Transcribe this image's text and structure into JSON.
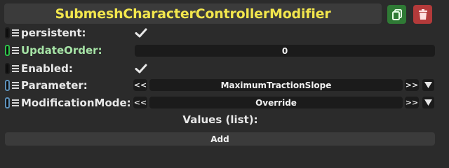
{
  "component": {
    "title": "SubmeshCharacterControllerModifier",
    "copy_icon": "copy-icon",
    "delete_icon": "trash-icon",
    "title_color": "#f2e64d"
  },
  "fields": {
    "persistent": {
      "label": "persistent:",
      "checked": true
    },
    "update_order": {
      "label": "UpdateOrder:",
      "value": "0"
    },
    "enabled": {
      "label": "Enabled:",
      "checked": true
    },
    "parameter": {
      "label": "Parameter:",
      "value": "MaximumTractionSlope",
      "prev": "<<",
      "next": ">>"
    },
    "modification_mode": {
      "label": "ModificationMode:",
      "value": "Override",
      "prev": "<<",
      "next": ">>"
    }
  },
  "values": {
    "title": "Values (list):",
    "add_label": "Add"
  }
}
